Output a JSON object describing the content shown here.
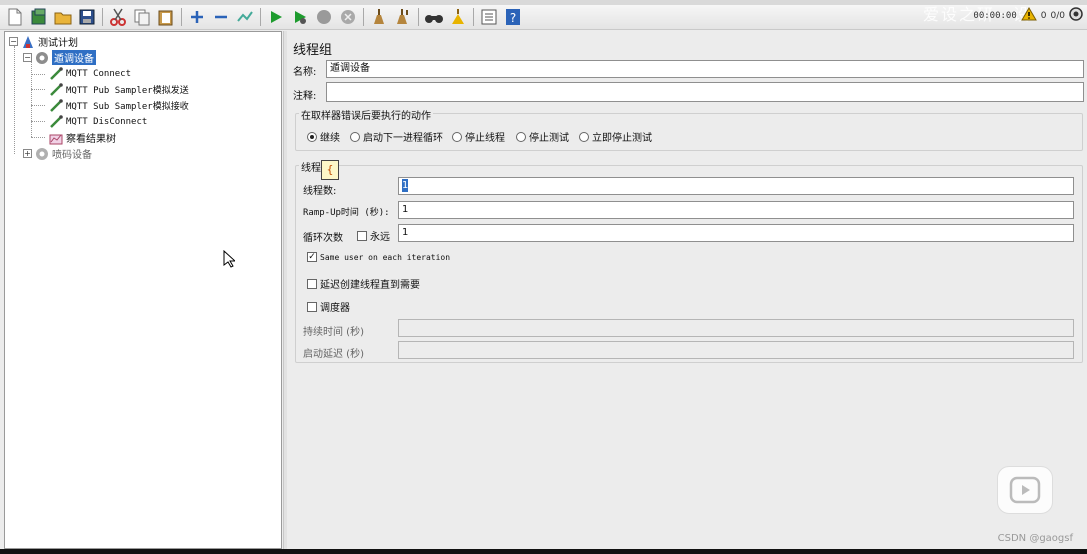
{
  "toolbar": {
    "items": [
      "new-icon",
      "templates-icon",
      "open-icon",
      "save-icon",
      "cut-icon",
      "copy-icon",
      "paste-icon",
      "expand-icon",
      "collapse-icon",
      "toggle-icon",
      "start-icon",
      "start-no-pause-icon",
      "stop-icon",
      "shutdown-icon",
      "clear-icon",
      "clear-all-icon",
      "search-icon",
      "reset-search-icon",
      "function-helper-icon",
      "help-icon"
    ],
    "timer": "00:00:00",
    "warning_count": "0",
    "thread_count": "0/0",
    "watermark": "爱设之研一设"
  },
  "tree": {
    "nodes": [
      {
        "label": "测试计划",
        "icon": "test-plan-icon"
      },
      {
        "label": "遁调设备",
        "icon": "thread-group-icon"
      },
      {
        "label": "MQTT Connect",
        "icon": "sampler-icon"
      },
      {
        "label": "MQTT Pub Sampler模拟发送",
        "icon": "sampler-icon"
      },
      {
        "label": "MQTT Sub Sampler模拟接收",
        "icon": "sampler-icon"
      },
      {
        "label": "MQTT DisConnect",
        "icon": "sampler-icon"
      },
      {
        "label": "察看结果树",
        "icon": "listener-icon"
      },
      {
        "label": "喷码设备",
        "icon": "thread-group-icon"
      }
    ]
  },
  "panel": {
    "title": "线程组",
    "name_label": "名称:",
    "name_value": "遁调设备",
    "comment_label": "注释:",
    "comment_value": "",
    "on_error_title": "在取样器错误后要执行的动作",
    "on_error_options": [
      "继续",
      "启动下一进程循环",
      "停止线程",
      "停止测试",
      "立即停止测试"
    ],
    "on_error_selected": "继续",
    "thread_props_title": "线程",
    "tooltip_text": "{",
    "threads_label": "线程数:",
    "threads_value": "1",
    "rampup_label": "Ramp-Up时间 (秒):",
    "rampup_value": "1",
    "loop_label": "循环次数",
    "forever_label": "永远",
    "loop_value": "1",
    "same_user_label": "Same user on each iteration",
    "delay_label": "延迟创建线程直到需要",
    "scheduler_label": "调度器",
    "duration_label": "持续时间 (秒)",
    "startup_delay_label": "启动延迟 (秒)"
  },
  "overlay": {
    "csdn": "CSDN @gaogsf"
  },
  "colors": {
    "selection": "#2f6fc4",
    "run_green": "#1e9b2e",
    "warning": "#e8b400"
  }
}
